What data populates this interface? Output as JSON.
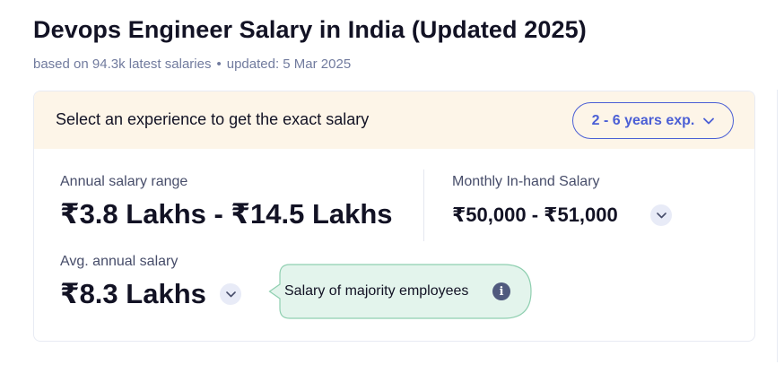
{
  "page": {
    "title": "Devops Engineer Salary in India (Updated 2025)",
    "based_on": "based on 94.3k latest salaries",
    "separator": "•",
    "updated": "updated: 5 Mar 2025"
  },
  "experience": {
    "prompt": "Select an experience to get the exact salary",
    "selected": "2 - 6 years exp.",
    "chevron_icon": "chevron-down-icon"
  },
  "salary": {
    "range_label": "Annual salary range",
    "range_value": "₹3.8 Lakhs - ₹14.5 Lakhs",
    "monthly_label": "Monthly In-hand Salary",
    "monthly_value": "₹50,000 - ₹51,000",
    "avg_label": "Avg. annual salary",
    "avg_value": "₹8.3 Lakhs",
    "callout": "Salary of majority employees",
    "info_glyph": "i"
  },
  "colors": {
    "accent": "#4b5fd5",
    "header_bg": "#fdf5e8",
    "callout_bg": "#e3f4ec",
    "callout_border": "#8fcfb0",
    "text": "#121224",
    "muted": "#717b9e"
  }
}
